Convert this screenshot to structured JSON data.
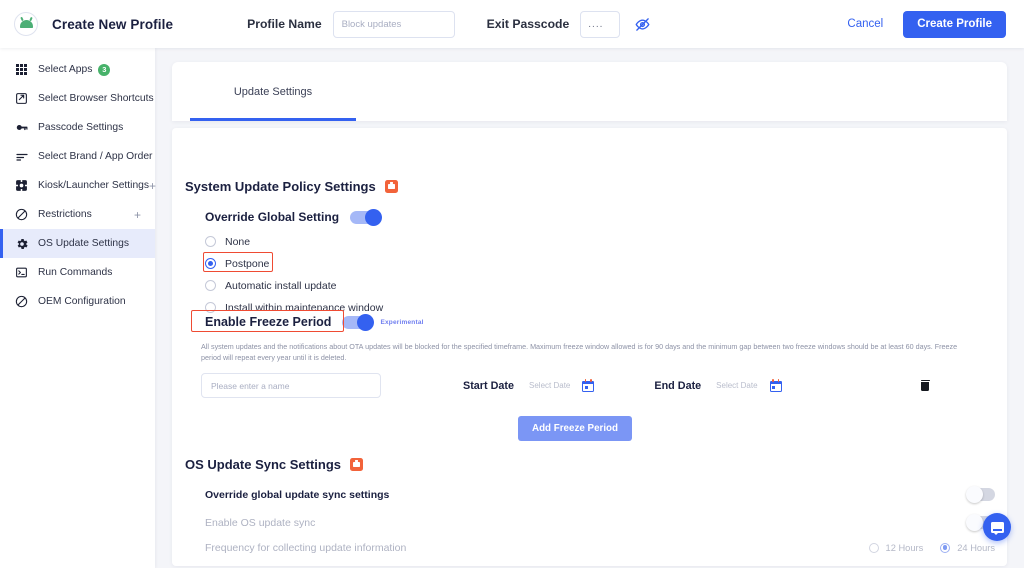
{
  "header": {
    "app_title": "Create New Profile",
    "logo_icon": "android-logo-icon",
    "profile_name_label": "Profile Name",
    "profile_name_value": "",
    "profile_name_placeholder": "Block updates",
    "exit_passcode_label": "Exit Passcode",
    "exit_passcode_value": "....",
    "eye_icon": "eye-off-icon",
    "cancel_label": "Cancel",
    "create_label": "Create Profile",
    "accent_color": "#3461f0"
  },
  "sidebar": {
    "items": [
      {
        "label": "Select Apps",
        "icon": "grid-icon",
        "badge": "3",
        "expandable": false,
        "active": false
      },
      {
        "label": "Select Browser Shortcuts",
        "icon": "browser-shortcut-icon",
        "badge": "",
        "expandable": false,
        "active": false
      },
      {
        "label": "Passcode Settings",
        "icon": "key-icon",
        "badge": "",
        "expandable": false,
        "active": false
      },
      {
        "label": "Select Brand / App Order",
        "icon": "sort-lines-icon",
        "badge": "",
        "expandable": false,
        "active": false
      },
      {
        "label": "Kiosk/Launcher Settings",
        "icon": "kiosk-icon",
        "badge": "",
        "expandable": true,
        "active": false
      },
      {
        "label": "Restrictions",
        "icon": "block-icon",
        "badge": "",
        "expandable": true,
        "active": false
      },
      {
        "label": "OS Update Settings",
        "icon": "gear-icon",
        "badge": "",
        "expandable": false,
        "active": true
      },
      {
        "label": "Run Commands",
        "icon": "terminal-icon",
        "badge": "",
        "expandable": false,
        "active": false
      },
      {
        "label": "OEM Configuration",
        "icon": "block-icon",
        "badge": "",
        "expandable": false,
        "active": false
      }
    ],
    "expand_symbol": "+",
    "active_bg": "#e7ebfb",
    "badge_color": "#47b26a"
  },
  "main": {
    "tabs": [
      {
        "label": "Update Settings",
        "active": true
      }
    ],
    "policy_section": {
      "title": "System Update Policy Settings",
      "work_badge_icon": "work-profile-icon",
      "work_badge_color": "#f2633a",
      "override_label": "Override Global Setting",
      "override_enabled": true,
      "options": [
        {
          "label": "None",
          "selected": false
        },
        {
          "label": "Postpone",
          "selected": true
        },
        {
          "label": "Automatic install update",
          "selected": false
        },
        {
          "label": "Install within maintenance window",
          "selected": false
        }
      ],
      "highlight_color": "#ef4b33"
    },
    "freeze": {
      "label": "Enable Freeze Period",
      "enabled": true,
      "experimental_tag": "Experimental",
      "experimental_color": "#6f7ef0",
      "description": "All system updates and the notifications about OTA updates will be blocked for the specified timeframe. Maximum freeze window allowed is for 90 days and the minimum gap between two freeze windows should be at least 60 days. Freeze period will repeat every year until it is deleted.",
      "name_value": "",
      "name_placeholder": "Please enter a name",
      "start_date_label": "Start Date",
      "start_date_value": "Select Date",
      "end_date_label": "End Date",
      "end_date_value": "Select Date",
      "calendar_icon": "calendar-icon",
      "delete_icon": "trash-icon",
      "add_button_label": "Add Freeze Period"
    },
    "sync_section": {
      "title": "OS Update Sync Settings",
      "work_badge_icon": "work-profile-icon",
      "rows": [
        {
          "label": "Override global update sync settings",
          "enabled": false,
          "dim": false
        },
        {
          "label": "Enable OS update sync",
          "enabled": false,
          "dim": true
        }
      ],
      "frequency_label": "Frequency for collecting update information",
      "frequency_options": [
        {
          "label": "12 Hours",
          "selected": false
        },
        {
          "label": "24 Hours",
          "selected": true
        }
      ]
    }
  },
  "chat": {
    "icon": "chat-bubble-icon",
    "color": "#3461f0"
  }
}
